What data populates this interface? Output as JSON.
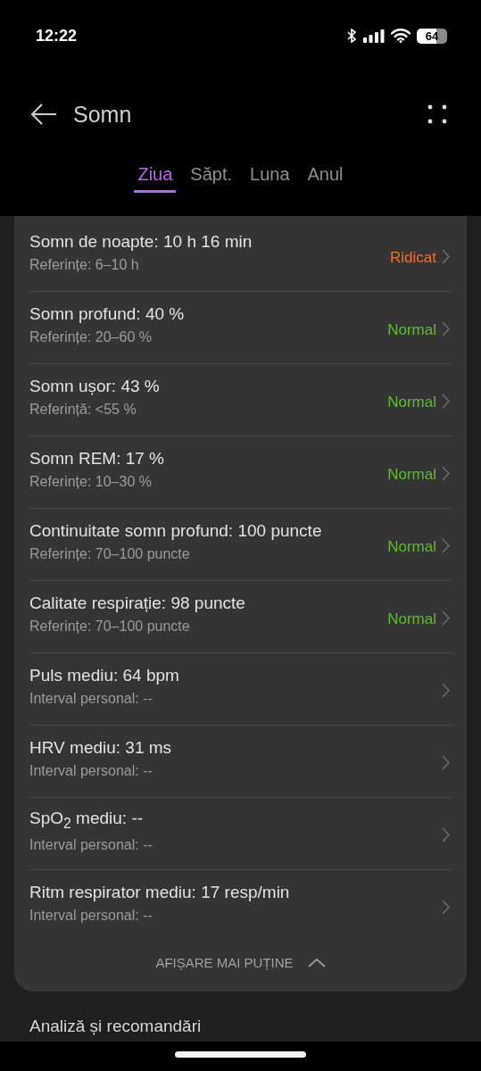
{
  "status_bar": {
    "time": "12:22",
    "battery": "64"
  },
  "app_bar": {
    "title": "Somn"
  },
  "tabs": [
    {
      "label": "Ziua",
      "selected": true
    },
    {
      "label": "Săpt.",
      "selected": false
    },
    {
      "label": "Luna",
      "selected": false
    },
    {
      "label": "Anul",
      "selected": false
    }
  ],
  "metrics": [
    {
      "title": "Somn de noapte: 10 h 16 min",
      "reference": "Referințe: 6–10 h",
      "status": "Ridicat",
      "color": "#f26b2b"
    },
    {
      "title": "Somn profund: 40 %",
      "reference": "Referințe: 20–60 %",
      "status": "Normal",
      "color": "#5fba2f"
    },
    {
      "title": "Somn ușor: 43 %",
      "reference": "Referință: <55 %",
      "status": "Normal",
      "color": "#5fba2f"
    },
    {
      "title": "Somn REM: 17 %",
      "reference": "Referințe: 10–30 %",
      "status": "Normal",
      "color": "#5fba2f"
    },
    {
      "title": "Continuitate somn profund: 100 puncte",
      "reference": "Referințe: 70–100 puncte",
      "status": "Normal",
      "color": "#5fba2f"
    },
    {
      "title": "Calitate respirație: 98 puncte",
      "reference": "Referințe: 70–100 puncte",
      "status": "Normal",
      "color": "#5fba2f"
    },
    {
      "title": "Puls mediu: 64 bpm",
      "reference": "Interval personal: --"
    },
    {
      "title": "HRV mediu: 31 ms",
      "reference": "Interval personal: --"
    },
    {
      "title": "SpO$_{2}$ mediu: --",
      "reference": "Interval personal: --"
    },
    {
      "title": "Ritm respirator mediu: 17 resp/min",
      "reference": "Interval personal: --"
    }
  ],
  "show_less": "AFIȘARE MAI PUȚINE",
  "section_title": "Analiză și recomandări"
}
